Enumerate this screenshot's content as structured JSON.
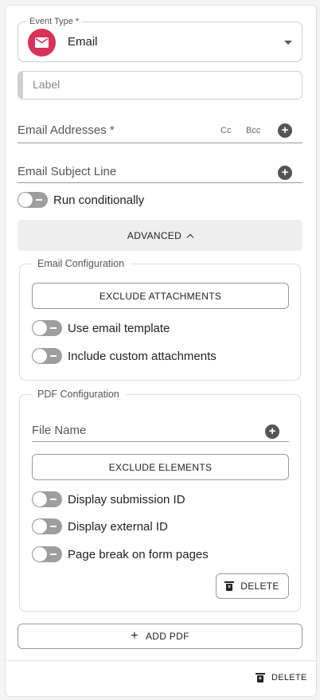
{
  "event_type": {
    "label": "Event Type *",
    "value": "Email",
    "icon": "envelope-icon",
    "badge_color": "#d6325a"
  },
  "label_field": {
    "placeholder": "Label",
    "value": ""
  },
  "email_addresses": {
    "label": "Email Addresses *",
    "cc": "Cc",
    "bcc": "Bcc"
  },
  "email_subject": {
    "label": "Email Subject Line"
  },
  "run_conditionally": {
    "label": "Run conditionally",
    "enabled": false
  },
  "advanced": {
    "label": "ADVANCED",
    "expanded": true
  },
  "email_config": {
    "legend": "Email Configuration",
    "exclude_button": "EXCLUDE ATTACHMENTS",
    "toggles": [
      {
        "label": "Use email template",
        "enabled": false
      },
      {
        "label": "Include custom attachments",
        "enabled": false
      }
    ]
  },
  "pdf_config": {
    "legend": "PDF Configuration",
    "file_name_label": "File Name",
    "exclude_button": "EXCLUDE ELEMENTS",
    "toggles": [
      {
        "label": "Display submission ID",
        "enabled": false
      },
      {
        "label": "Display external ID",
        "enabled": false
      },
      {
        "label": "Page break on form pages",
        "enabled": false
      }
    ],
    "delete_button": "DELETE"
  },
  "add_pdf_button": "ADD PDF",
  "footer": {
    "delete_button": "DELETE"
  }
}
